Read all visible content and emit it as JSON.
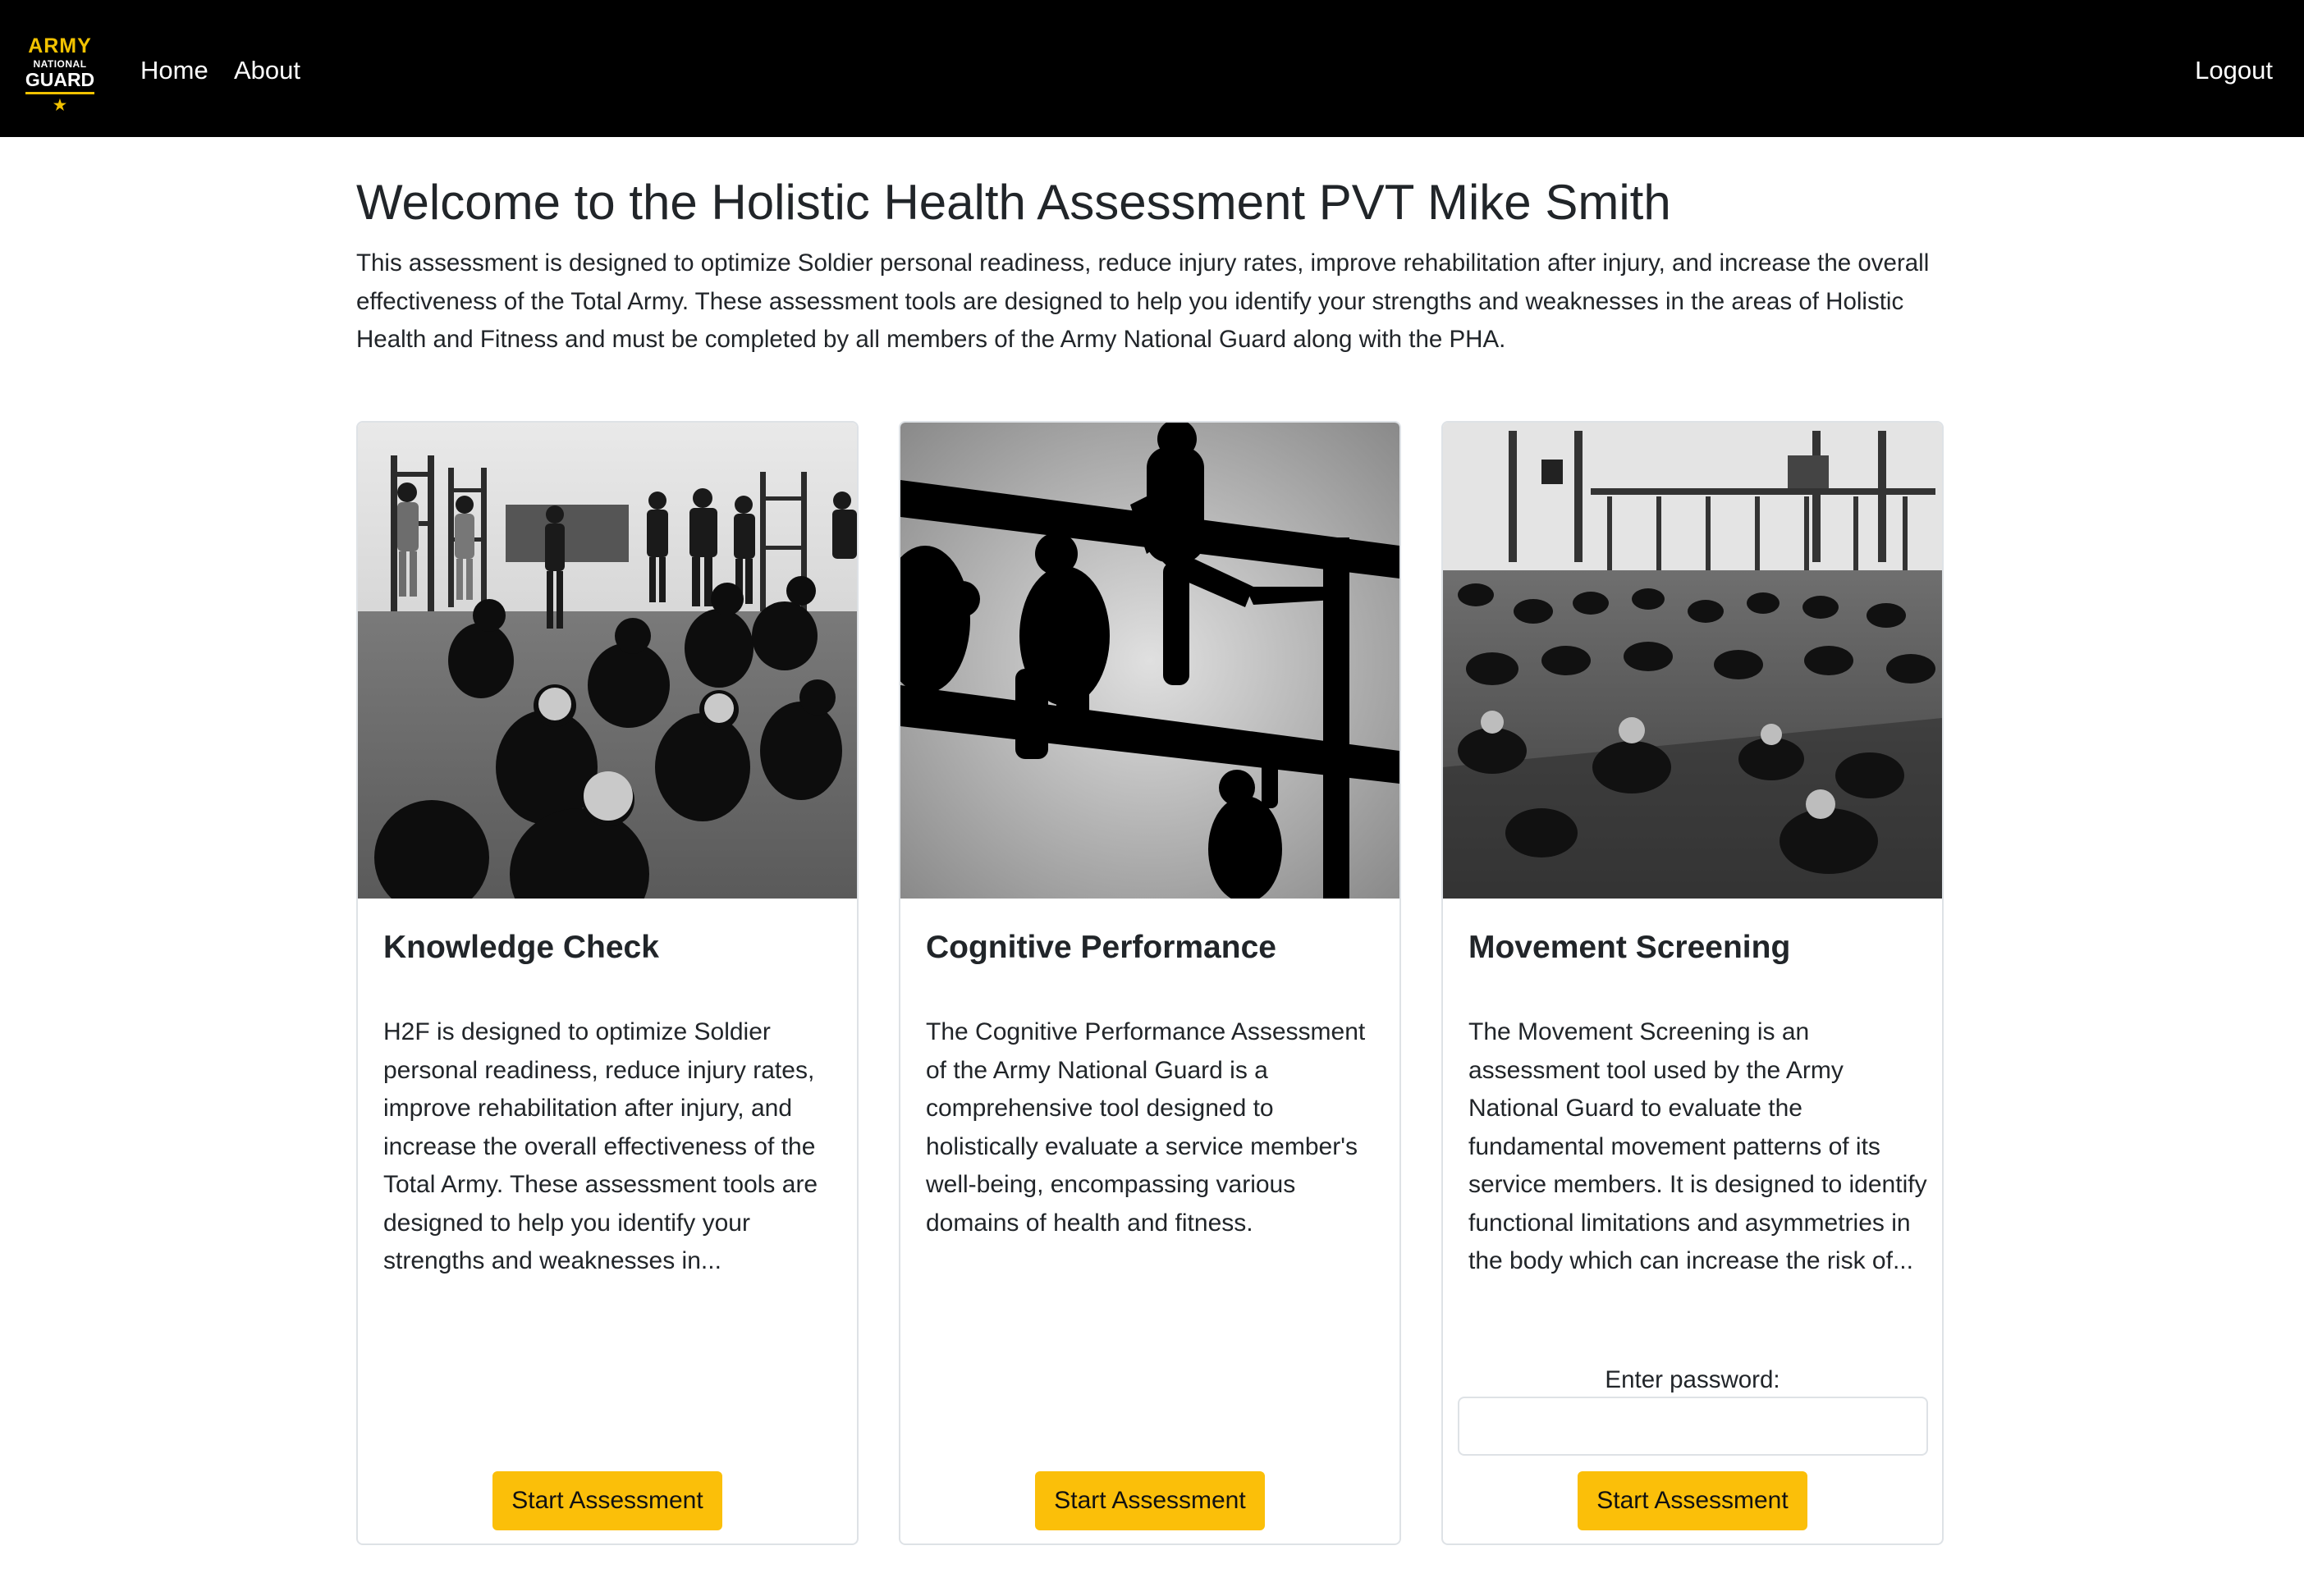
{
  "header": {
    "logo": {
      "line1": "ARMY",
      "line2": "NATIONAL",
      "line3": "GUARD",
      "star": "★"
    },
    "nav": [
      {
        "label": "Home"
      },
      {
        "label": "About"
      }
    ],
    "logout_label": "Logout"
  },
  "main": {
    "title": "Welcome to the Holistic Health Assessment PVT Mike Smith",
    "intro": "This assessment is designed to optimize Soldier personal readiness, reduce injury rates, improve rehabilitation after injury, and increase the overall effectiveness of the Total Army. These assessment tools are designed to help you identify your strengths and weaknesses in the areas of Holistic Health and Fitness and must be completed by all members of the Army National Guard along with the PHA.",
    "cards": [
      {
        "image": "group-briefing-photo",
        "title": "Knowledge Check",
        "text": "H2F is designed to optimize Soldier personal readiness, reduce injury rates, improve rehabilitation after injury, and increase the overall effectiveness of the Total Army. These assessment tools are designed to help you identify your strengths and weaknesses in...",
        "button_label": "Start Assessment"
      },
      {
        "image": "obstacle-climb-silhouette-photo",
        "title": "Cognitive Performance",
        "text": "The Cognitive Performance Assessment of the Army National Guard is a comprehensive tool designed to holistically evaluate a service member's well-being, encompassing various domains of health and fitness.",
        "button_label": "Start Assessment"
      },
      {
        "image": "gym-stretching-class-photo",
        "title": "Movement Screening",
        "text": "The Movement Screening is an assessment tool used by the Army National Guard to evaluate the fundamental movement patterns of its service members. It is designed to identify functional limitations and asymmetries in the body which can increase the risk of...",
        "password_label": "Enter password:",
        "password_value": "",
        "button_label": "Start Assessment"
      }
    ]
  },
  "colors": {
    "navbar": "#000000",
    "accent": "#fbbf09",
    "logo_gold": "#f2c200",
    "border": "#dee2e6"
  }
}
